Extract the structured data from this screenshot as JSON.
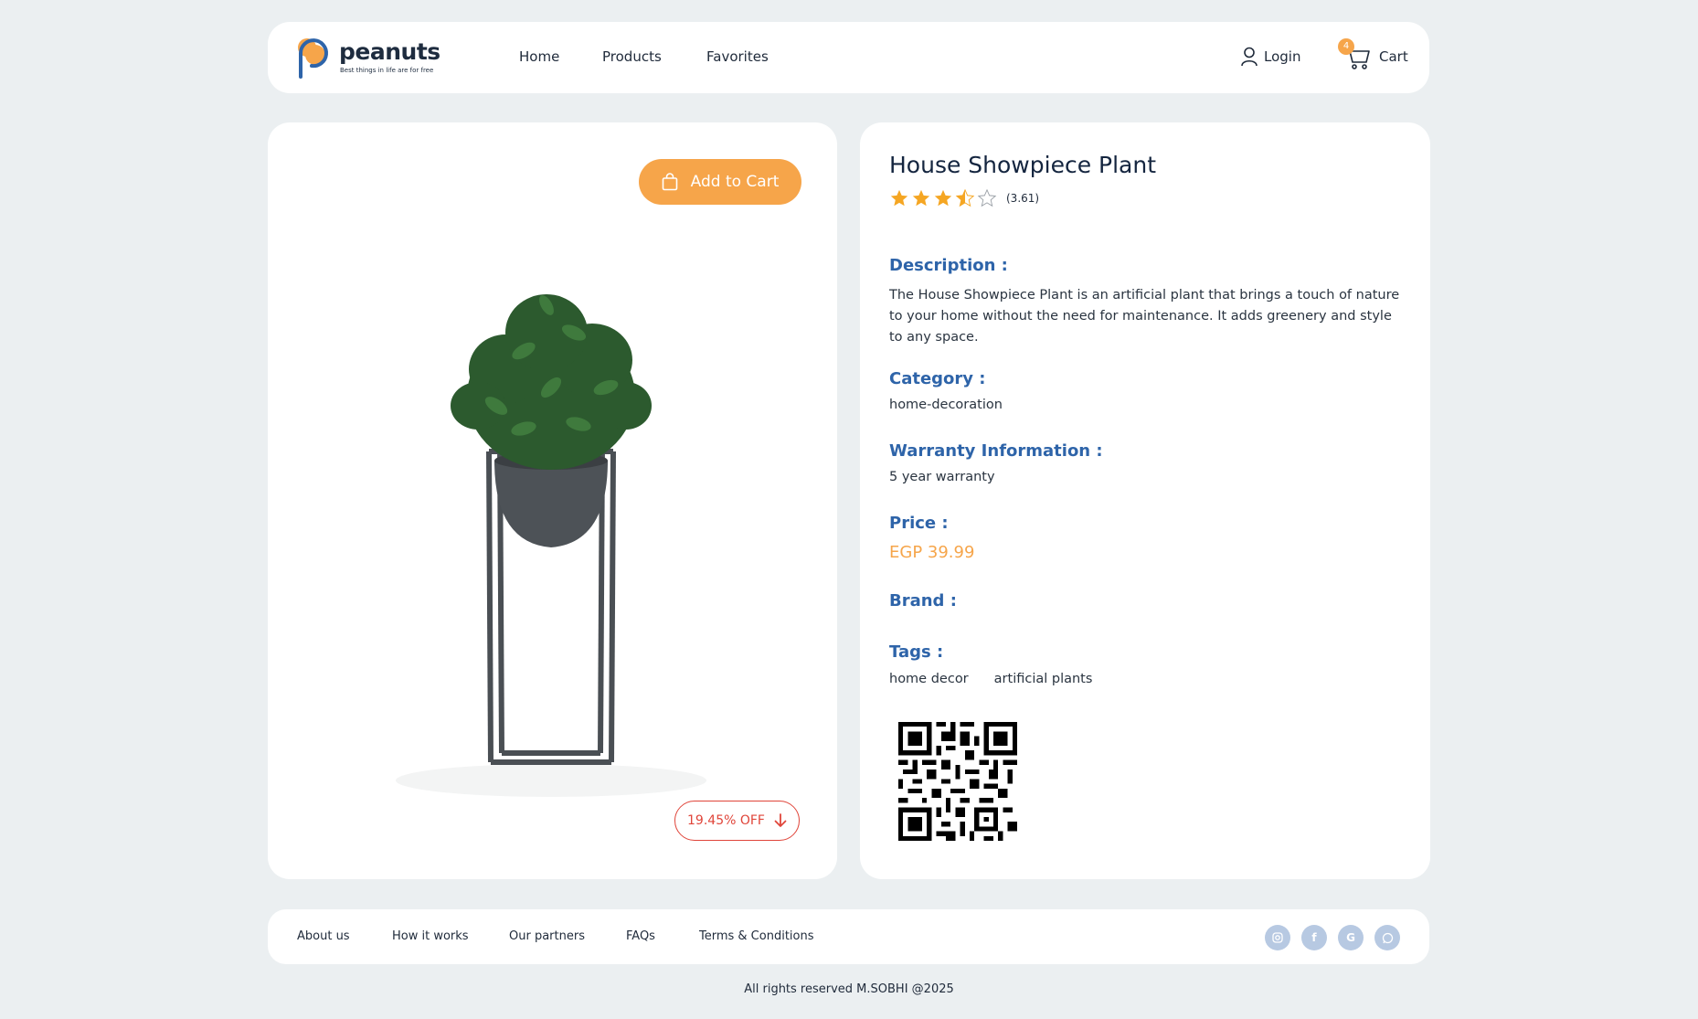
{
  "brand": {
    "name": "peanuts",
    "tagline": "Best things in life are for free"
  },
  "colors": {
    "accent": "#f6a54a",
    "label_blue": "#2e64a9",
    "discount_red": "#e0453a",
    "background": "#ebeff1"
  },
  "nav": {
    "home": "Home",
    "products": "Products",
    "favorites": "Favorites",
    "login": "Login",
    "cart": "Cart",
    "cart_count": "4"
  },
  "product": {
    "add_to_cart": "Add to Cart",
    "discount": "19.45% OFF",
    "title": "House Showpiece Plant",
    "rating": 3.61,
    "rating_text": "(3.61)",
    "description_label": "Description :",
    "description": "The House Showpiece Plant is an artificial plant that brings a touch of nature to your home without the need for maintenance. It adds greenery and style to any space.",
    "category_label": "Category :",
    "category": "home-decoration",
    "warranty_label": "Warranty Information :",
    "warranty": "5 year warranty",
    "price_label": "Price :",
    "price": "EGP 39.99",
    "brand_label": "Brand :",
    "tags_label": "Tags :",
    "tags": [
      "home decor",
      "artificial plants"
    ]
  },
  "footer": {
    "links": [
      "About us",
      "How it works",
      "Our partners",
      "FAQs",
      "Terms & Conditions"
    ],
    "social_icons": [
      "instagram-icon",
      "facebook-icon",
      "google-icon",
      "whatsapp-icon"
    ],
    "copyright": "All rights reserved M.SOBHI @2025"
  }
}
